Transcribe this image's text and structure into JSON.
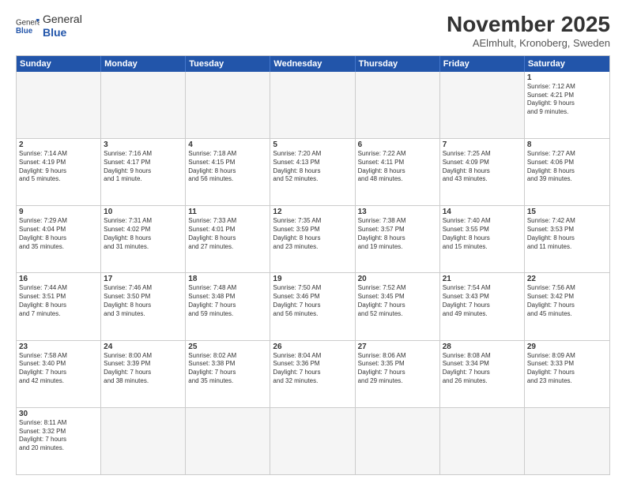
{
  "logo": {
    "text_general": "General",
    "text_blue": "Blue"
  },
  "title": "November 2025",
  "location": "AElmhult, Kronoberg, Sweden",
  "header_days": [
    "Sunday",
    "Monday",
    "Tuesday",
    "Wednesday",
    "Thursday",
    "Friday",
    "Saturday"
  ],
  "rows": [
    [
      {
        "day": "",
        "info": ""
      },
      {
        "day": "",
        "info": ""
      },
      {
        "day": "",
        "info": ""
      },
      {
        "day": "",
        "info": ""
      },
      {
        "day": "",
        "info": ""
      },
      {
        "day": "",
        "info": ""
      },
      {
        "day": "1",
        "info": "Sunrise: 7:12 AM\nSunset: 4:21 PM\nDaylight: 9 hours\nand 9 minutes."
      }
    ],
    [
      {
        "day": "2",
        "info": "Sunrise: 7:14 AM\nSunset: 4:19 PM\nDaylight: 9 hours\nand 5 minutes."
      },
      {
        "day": "3",
        "info": "Sunrise: 7:16 AM\nSunset: 4:17 PM\nDaylight: 9 hours\nand 1 minute."
      },
      {
        "day": "4",
        "info": "Sunrise: 7:18 AM\nSunset: 4:15 PM\nDaylight: 8 hours\nand 56 minutes."
      },
      {
        "day": "5",
        "info": "Sunrise: 7:20 AM\nSunset: 4:13 PM\nDaylight: 8 hours\nand 52 minutes."
      },
      {
        "day": "6",
        "info": "Sunrise: 7:22 AM\nSunset: 4:11 PM\nDaylight: 8 hours\nand 48 minutes."
      },
      {
        "day": "7",
        "info": "Sunrise: 7:25 AM\nSunset: 4:09 PM\nDaylight: 8 hours\nand 43 minutes."
      },
      {
        "day": "8",
        "info": "Sunrise: 7:27 AM\nSunset: 4:06 PM\nDaylight: 8 hours\nand 39 minutes."
      }
    ],
    [
      {
        "day": "9",
        "info": "Sunrise: 7:29 AM\nSunset: 4:04 PM\nDaylight: 8 hours\nand 35 minutes."
      },
      {
        "day": "10",
        "info": "Sunrise: 7:31 AM\nSunset: 4:02 PM\nDaylight: 8 hours\nand 31 minutes."
      },
      {
        "day": "11",
        "info": "Sunrise: 7:33 AM\nSunset: 4:01 PM\nDaylight: 8 hours\nand 27 minutes."
      },
      {
        "day": "12",
        "info": "Sunrise: 7:35 AM\nSunset: 3:59 PM\nDaylight: 8 hours\nand 23 minutes."
      },
      {
        "day": "13",
        "info": "Sunrise: 7:38 AM\nSunset: 3:57 PM\nDaylight: 8 hours\nand 19 minutes."
      },
      {
        "day": "14",
        "info": "Sunrise: 7:40 AM\nSunset: 3:55 PM\nDaylight: 8 hours\nand 15 minutes."
      },
      {
        "day": "15",
        "info": "Sunrise: 7:42 AM\nSunset: 3:53 PM\nDaylight: 8 hours\nand 11 minutes."
      }
    ],
    [
      {
        "day": "16",
        "info": "Sunrise: 7:44 AM\nSunset: 3:51 PM\nDaylight: 8 hours\nand 7 minutes."
      },
      {
        "day": "17",
        "info": "Sunrise: 7:46 AM\nSunset: 3:50 PM\nDaylight: 8 hours\nand 3 minutes."
      },
      {
        "day": "18",
        "info": "Sunrise: 7:48 AM\nSunset: 3:48 PM\nDaylight: 7 hours\nand 59 minutes."
      },
      {
        "day": "19",
        "info": "Sunrise: 7:50 AM\nSunset: 3:46 PM\nDaylight: 7 hours\nand 56 minutes."
      },
      {
        "day": "20",
        "info": "Sunrise: 7:52 AM\nSunset: 3:45 PM\nDaylight: 7 hours\nand 52 minutes."
      },
      {
        "day": "21",
        "info": "Sunrise: 7:54 AM\nSunset: 3:43 PM\nDaylight: 7 hours\nand 49 minutes."
      },
      {
        "day": "22",
        "info": "Sunrise: 7:56 AM\nSunset: 3:42 PM\nDaylight: 7 hours\nand 45 minutes."
      }
    ],
    [
      {
        "day": "23",
        "info": "Sunrise: 7:58 AM\nSunset: 3:40 PM\nDaylight: 7 hours\nand 42 minutes."
      },
      {
        "day": "24",
        "info": "Sunrise: 8:00 AM\nSunset: 3:39 PM\nDaylight: 7 hours\nand 38 minutes."
      },
      {
        "day": "25",
        "info": "Sunrise: 8:02 AM\nSunset: 3:38 PM\nDaylight: 7 hours\nand 35 minutes."
      },
      {
        "day": "26",
        "info": "Sunrise: 8:04 AM\nSunset: 3:36 PM\nDaylight: 7 hours\nand 32 minutes."
      },
      {
        "day": "27",
        "info": "Sunrise: 8:06 AM\nSunset: 3:35 PM\nDaylight: 7 hours\nand 29 minutes."
      },
      {
        "day": "28",
        "info": "Sunrise: 8:08 AM\nSunset: 3:34 PM\nDaylight: 7 hours\nand 26 minutes."
      },
      {
        "day": "29",
        "info": "Sunrise: 8:09 AM\nSunset: 3:33 PM\nDaylight: 7 hours\nand 23 minutes."
      }
    ],
    [
      {
        "day": "30",
        "info": "Sunrise: 8:11 AM\nSunset: 3:32 PM\nDaylight: 7 hours\nand 20 minutes."
      },
      {
        "day": "",
        "info": ""
      },
      {
        "day": "",
        "info": ""
      },
      {
        "day": "",
        "info": ""
      },
      {
        "day": "",
        "info": ""
      },
      {
        "day": "",
        "info": ""
      },
      {
        "day": "",
        "info": ""
      }
    ]
  ]
}
